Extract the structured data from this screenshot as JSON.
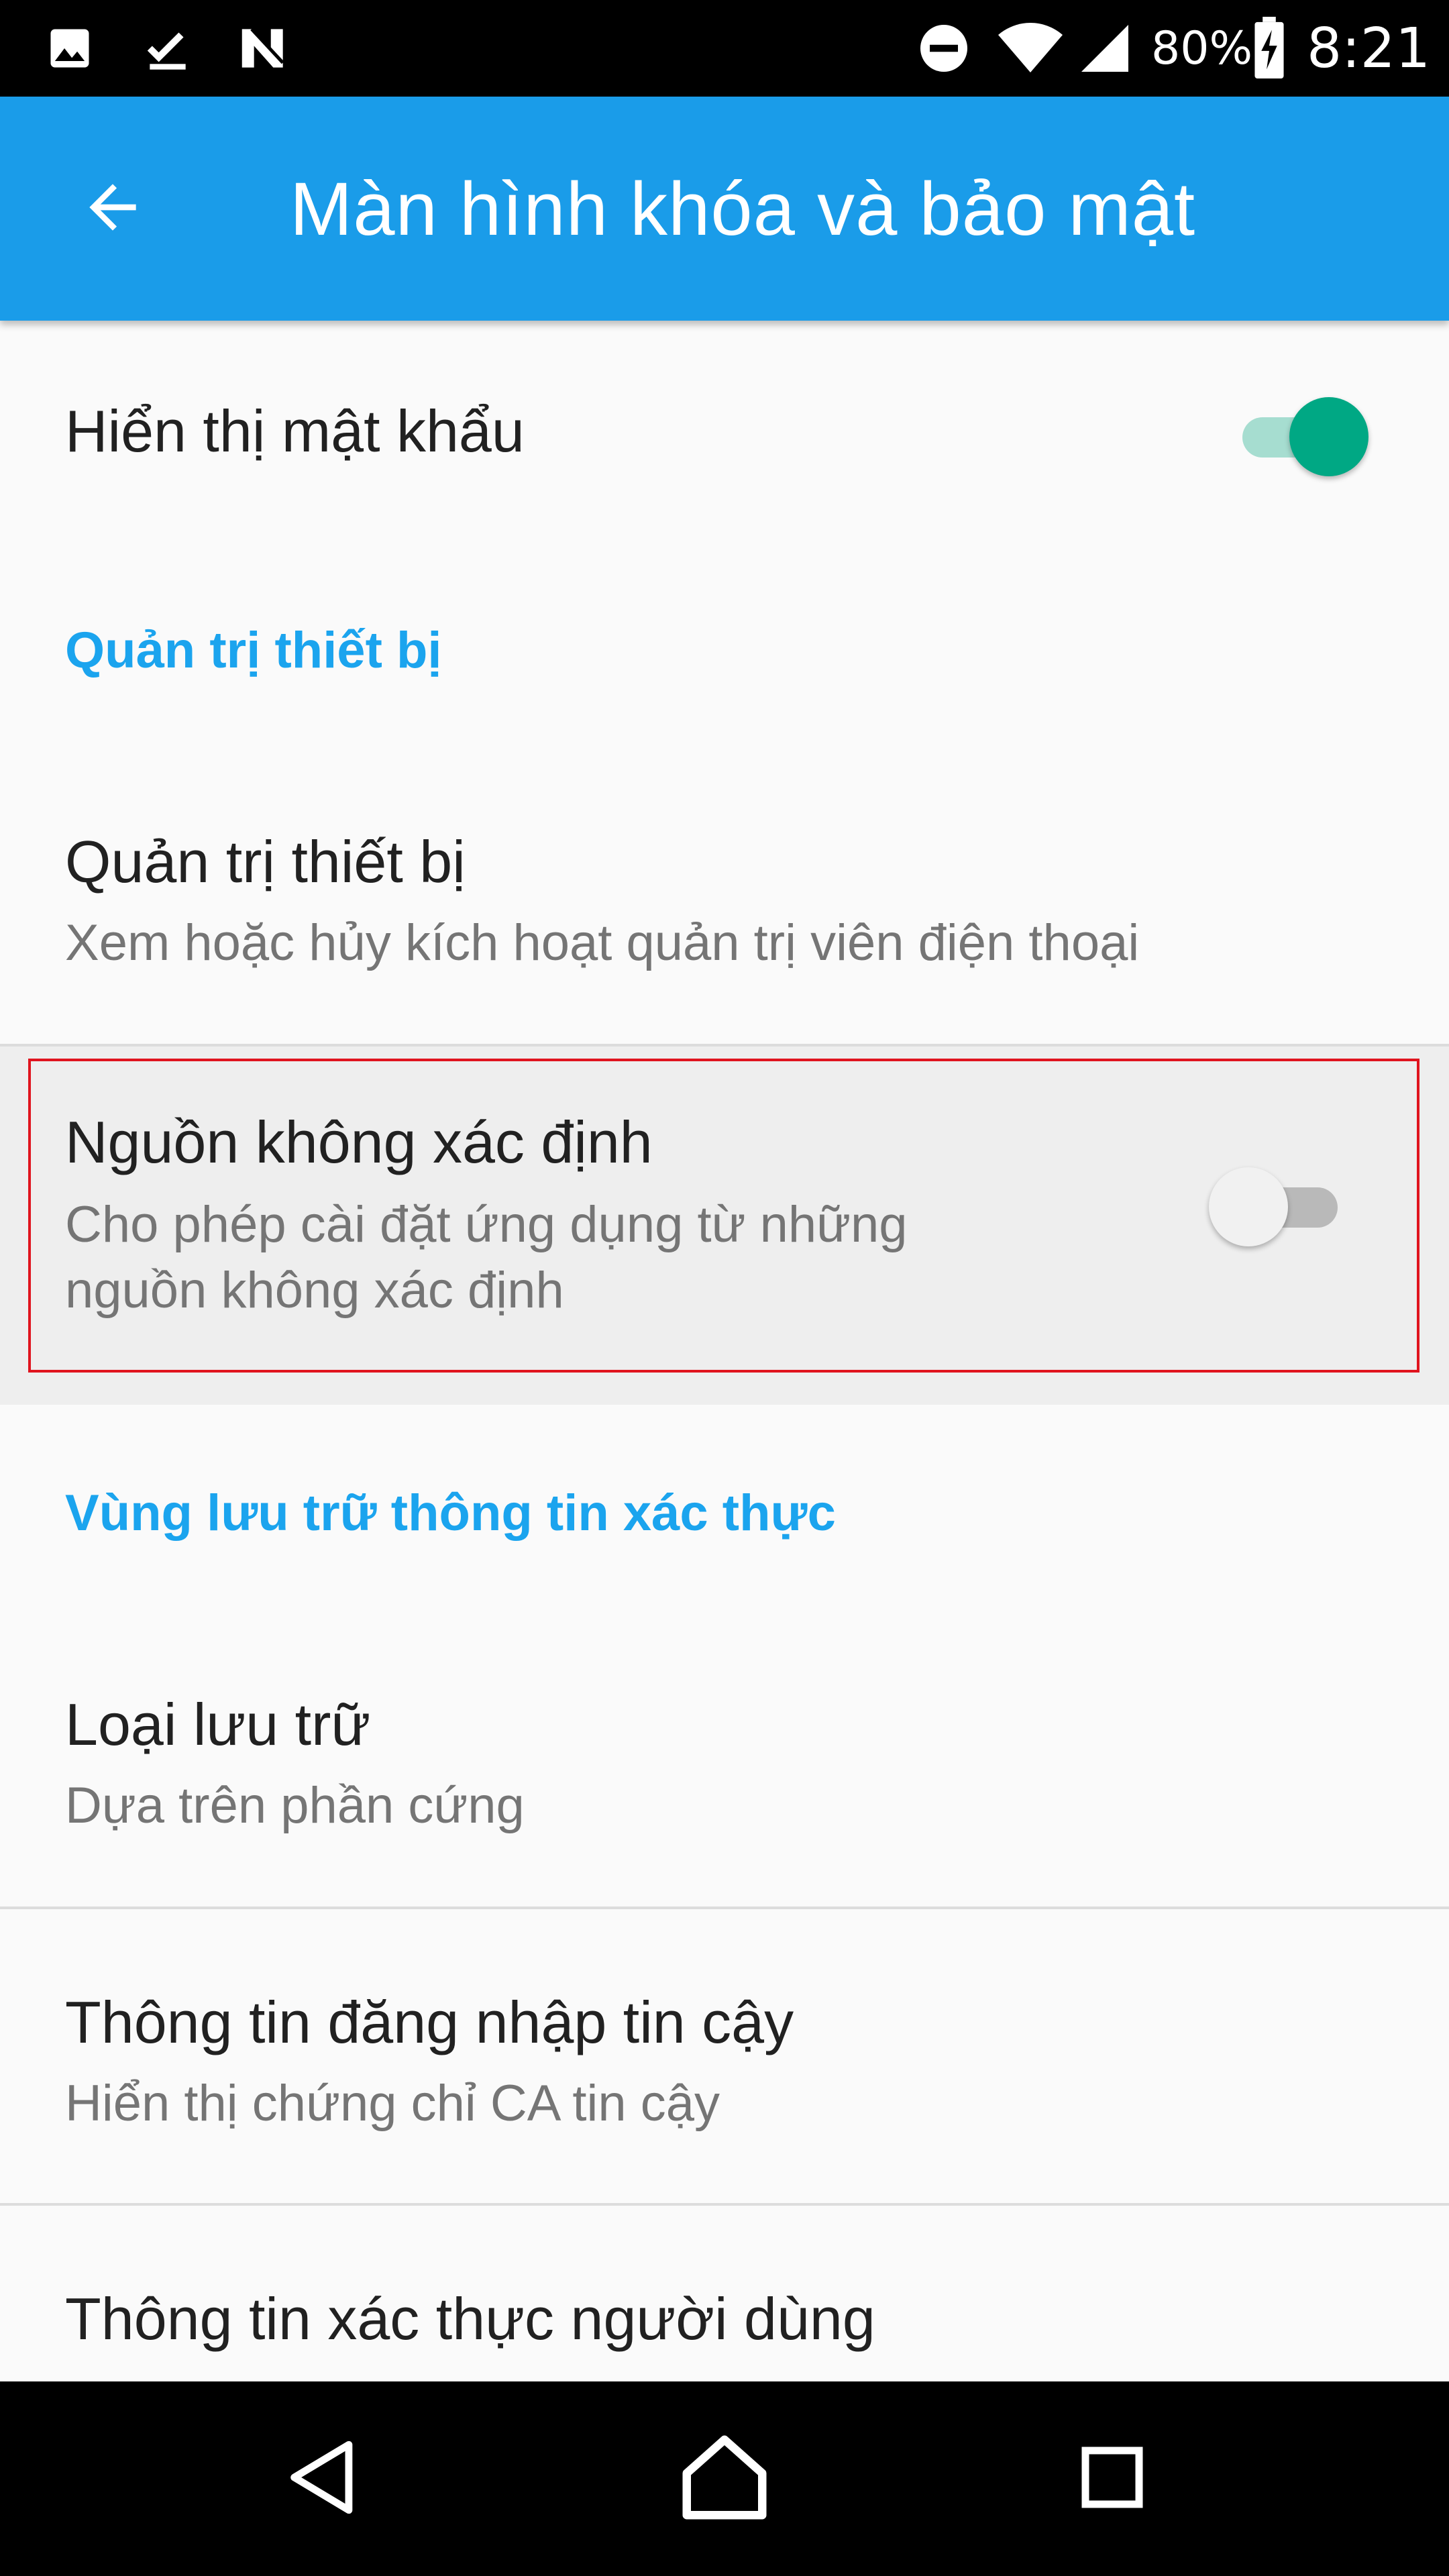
{
  "status_bar": {
    "battery_percent": "80%",
    "time": "8:21",
    "icons": [
      "image-icon",
      "download-done-icon",
      "n-icon",
      "do-not-disturb-icon",
      "wifi-icon",
      "signal-icon",
      "battery-charging-icon"
    ]
  },
  "app_bar": {
    "title": "Màn hình khóa và bảo mật",
    "back_icon": "arrow-back-icon"
  },
  "settings": {
    "show_password": {
      "title": "Hiển thị mật khẩu",
      "enabled": true
    },
    "device_admin_section": "Quản trị thiết bị",
    "device_admin": {
      "title": "Quản trị thiết bị",
      "subtitle": "Xem hoặc hủy kích hoạt quản trị viên điện thoại"
    },
    "unknown_sources": {
      "title": "Nguồn không xác định",
      "subtitle_line1": "Cho phép cài đặt ứng dụng từ những",
      "subtitle_line2": "nguồn không xác định",
      "enabled": false
    },
    "credential_storage_section": "Vùng lưu trữ thông tin xác thực",
    "storage_type": {
      "title": "Loại lưu trữ",
      "subtitle": "Dựa trên phần cứng"
    },
    "trusted_credentials": {
      "title": "Thông tin đăng nhập tin cậy",
      "subtitle": "Hiển thị chứng chỉ CA tin cậy"
    },
    "user_credentials": {
      "title": "Thông tin xác thực người dùng"
    }
  },
  "colors": {
    "app_bar": "#1a9ce9",
    "accent": "#1ba4ee",
    "toggle_on_thumb": "#00a884",
    "toggle_on_track": "#a6ddd0",
    "highlight_border": "#e0141e"
  },
  "nav_bar": {
    "icons": [
      "back-triangle-icon",
      "home-icon",
      "recents-icon"
    ]
  }
}
